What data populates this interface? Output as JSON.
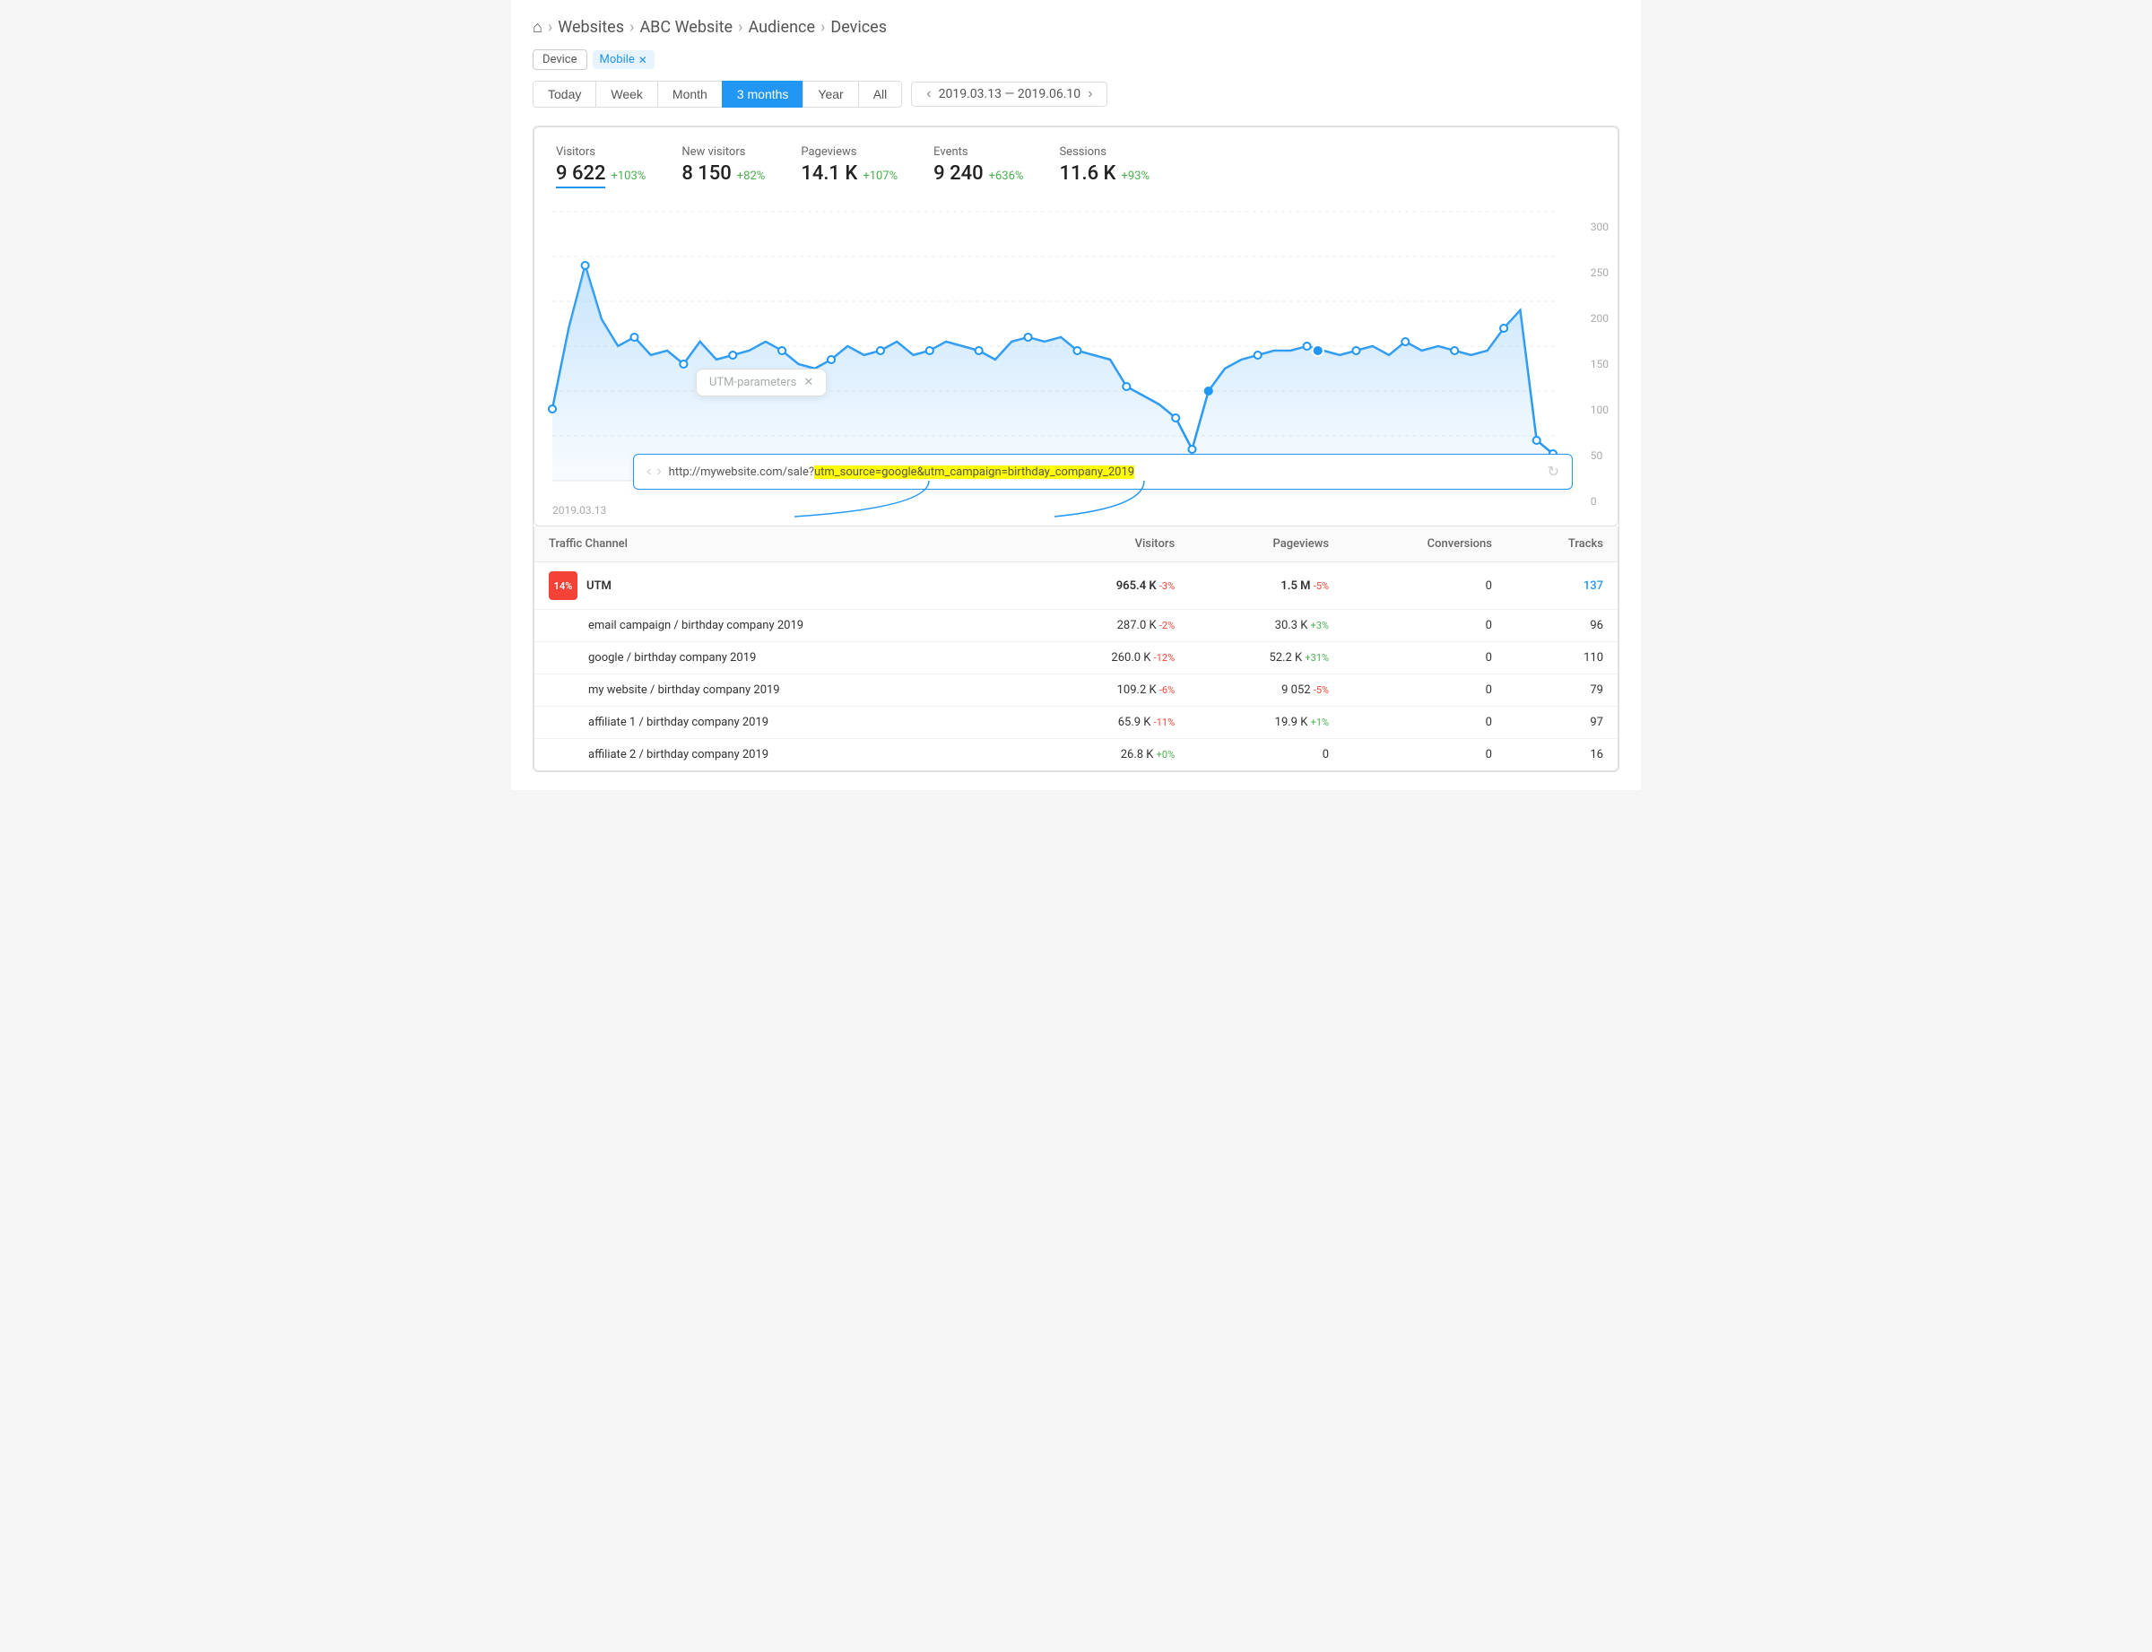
{
  "breadcrumb": {
    "home": "⌂",
    "items": [
      "Websites",
      "ABC Website",
      "Audience",
      "Devices"
    ]
  },
  "filters": {
    "device_label": "Device",
    "mobile_label": "Mobile"
  },
  "period_buttons": [
    "Today",
    "Week",
    "Month",
    "3 months",
    "Year",
    "All"
  ],
  "active_period": "3 months",
  "date_range": "2019.03.13 — 2019.06.10",
  "stats": [
    {
      "label": "Visitors",
      "value": "9 622",
      "change": "+103%",
      "underline": true
    },
    {
      "label": "New visitors",
      "value": "8 150",
      "change": "+82%"
    },
    {
      "label": "Pageviews",
      "value": "14.1 K",
      "change": "+107%"
    },
    {
      "label": "Events",
      "value": "9 240",
      "change": "+636%"
    },
    {
      "label": "Sessions",
      "value": "11.6 K",
      "change": "+93%"
    }
  ],
  "chart": {
    "y_labels": [
      "300",
      "250",
      "200",
      "150",
      "100",
      "50",
      "0"
    ],
    "x_label": "2019.03.13",
    "utm_label": "UTM-parameters",
    "url_text_before": "http://mywebsite.com/sale?",
    "url_highlight": "utm_source=google&utm_campaign=birthday_company_2019"
  },
  "table": {
    "headers": [
      "Traffic Channel",
      "Visitors",
      "Pageviews",
      "Conversions",
      "Tracks"
    ],
    "rows": [
      {
        "indent": false,
        "badge": "14%",
        "channel": "UTM",
        "visitors": "965.4 K",
        "visitors_change": "-3%",
        "pageviews": "1.5 M",
        "pageviews_change": "-5%",
        "conversions": "0",
        "tracks": "137",
        "bold": true
      },
      {
        "indent": true,
        "channel": "email campaign / birthday company 2019",
        "visitors": "287.0 K",
        "visitors_change": "-2%",
        "pageviews": "30.3 K",
        "pageviews_change": "+3%",
        "conversions": "0",
        "tracks": "96"
      },
      {
        "indent": true,
        "channel": "google / birthday company 2019",
        "visitors": "260.0 K",
        "visitors_change": "-12%",
        "pageviews": "52.2 K",
        "pageviews_change": "+31%",
        "conversions": "0",
        "tracks": "110"
      },
      {
        "indent": true,
        "channel": "my website / birthday company 2019",
        "visitors": "109.2 K",
        "visitors_change": "-6%",
        "pageviews": "9 052",
        "pageviews_change": "-5%",
        "conversions": "0",
        "tracks": "79"
      },
      {
        "indent": true,
        "channel": "affiliate 1 / birthday company 2019",
        "visitors": "65.9 K",
        "visitors_change": "-11%",
        "pageviews": "19.9 K",
        "pageviews_change": "+1%",
        "conversions": "0",
        "tracks": "97"
      },
      {
        "indent": true,
        "channel": "affiliate 2 / birthday company 2019",
        "visitors": "26.8 K",
        "visitors_change": "+0%",
        "pageviews": "0",
        "pageviews_change": "",
        "conversions": "0",
        "tracks": "16"
      }
    ]
  }
}
